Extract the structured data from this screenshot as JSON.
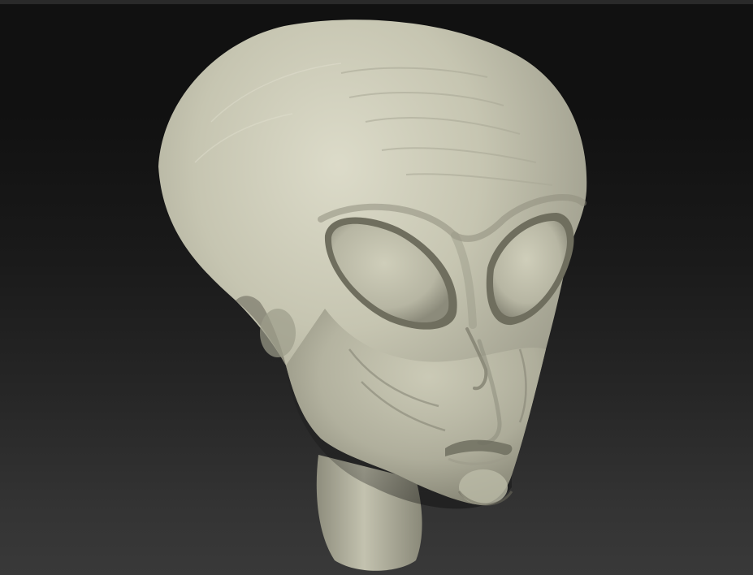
{
  "viewport": {
    "background_top": "#111111",
    "background_bottom": "#393939"
  },
  "model": {
    "subject": "alien-head-sculpt",
    "material_color": "#c9c8b4",
    "shadow_color": "#6f6e5e",
    "highlight_color": "#e4e3d2"
  }
}
